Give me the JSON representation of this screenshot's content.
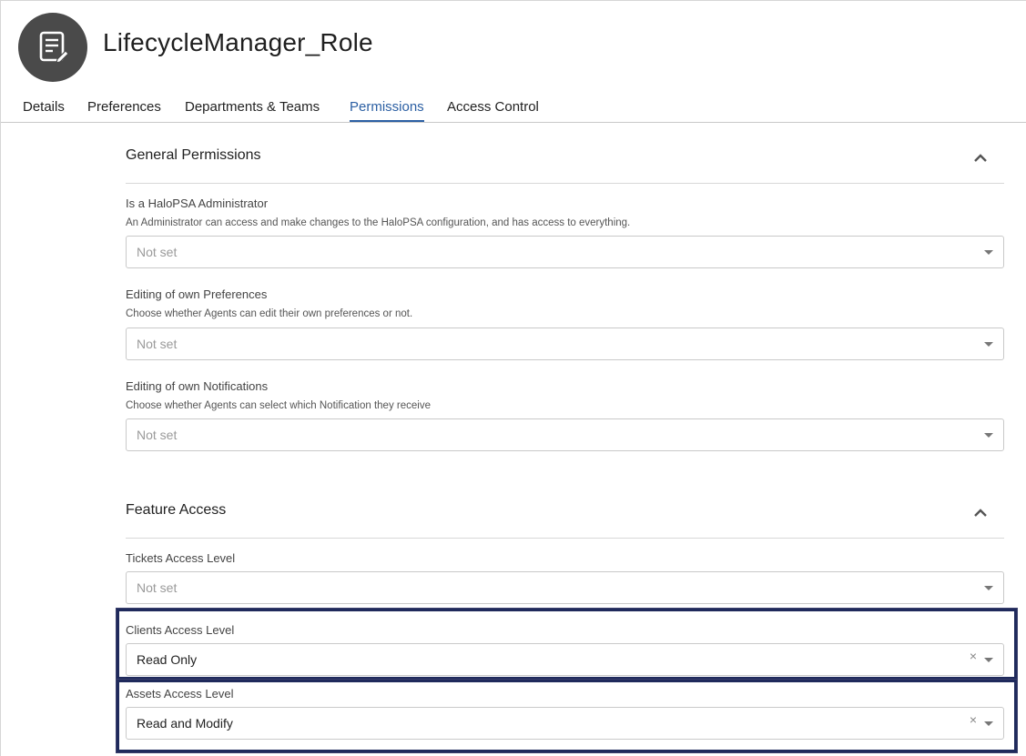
{
  "header": {
    "title": "LifecycleManager_Role",
    "avatar_icon": "document-edit-icon"
  },
  "tabs": [
    {
      "label": "Details",
      "active": false
    },
    {
      "label": "Preferences",
      "active": false
    },
    {
      "label": "Departments & Teams",
      "active": false
    },
    {
      "label": "Permissions",
      "active": true
    },
    {
      "label": "Access Control",
      "active": false
    }
  ],
  "general_permissions": {
    "title": "General Permissions",
    "fields": [
      {
        "label": "Is a HaloPSA Administrator",
        "description": "An Administrator can access and make changes to the HaloPSA configuration, and has access to everything.",
        "value": "Not set"
      },
      {
        "label": "Editing of own Preferences",
        "description": "Choose whether Agents can edit their own preferences or not.",
        "value": "Not set"
      },
      {
        "label": "Editing of own Notifications",
        "description": "Choose whether Agents can select which Notification they receive",
        "value": "Not set"
      }
    ]
  },
  "feature_access": {
    "title": "Feature Access",
    "fields": [
      {
        "label": "Tickets Access Level",
        "value": "Not set"
      },
      {
        "label": "Clients Access Level",
        "value": "Read Only",
        "clear": "×"
      },
      {
        "label": "Assets Access Level",
        "value": "Read and Modify",
        "clear": "×"
      }
    ]
  },
  "colors": {
    "accent": "#2b5fa3",
    "highlight_border": "#1f2a5c",
    "avatar_bg": "#4a4a4a"
  }
}
